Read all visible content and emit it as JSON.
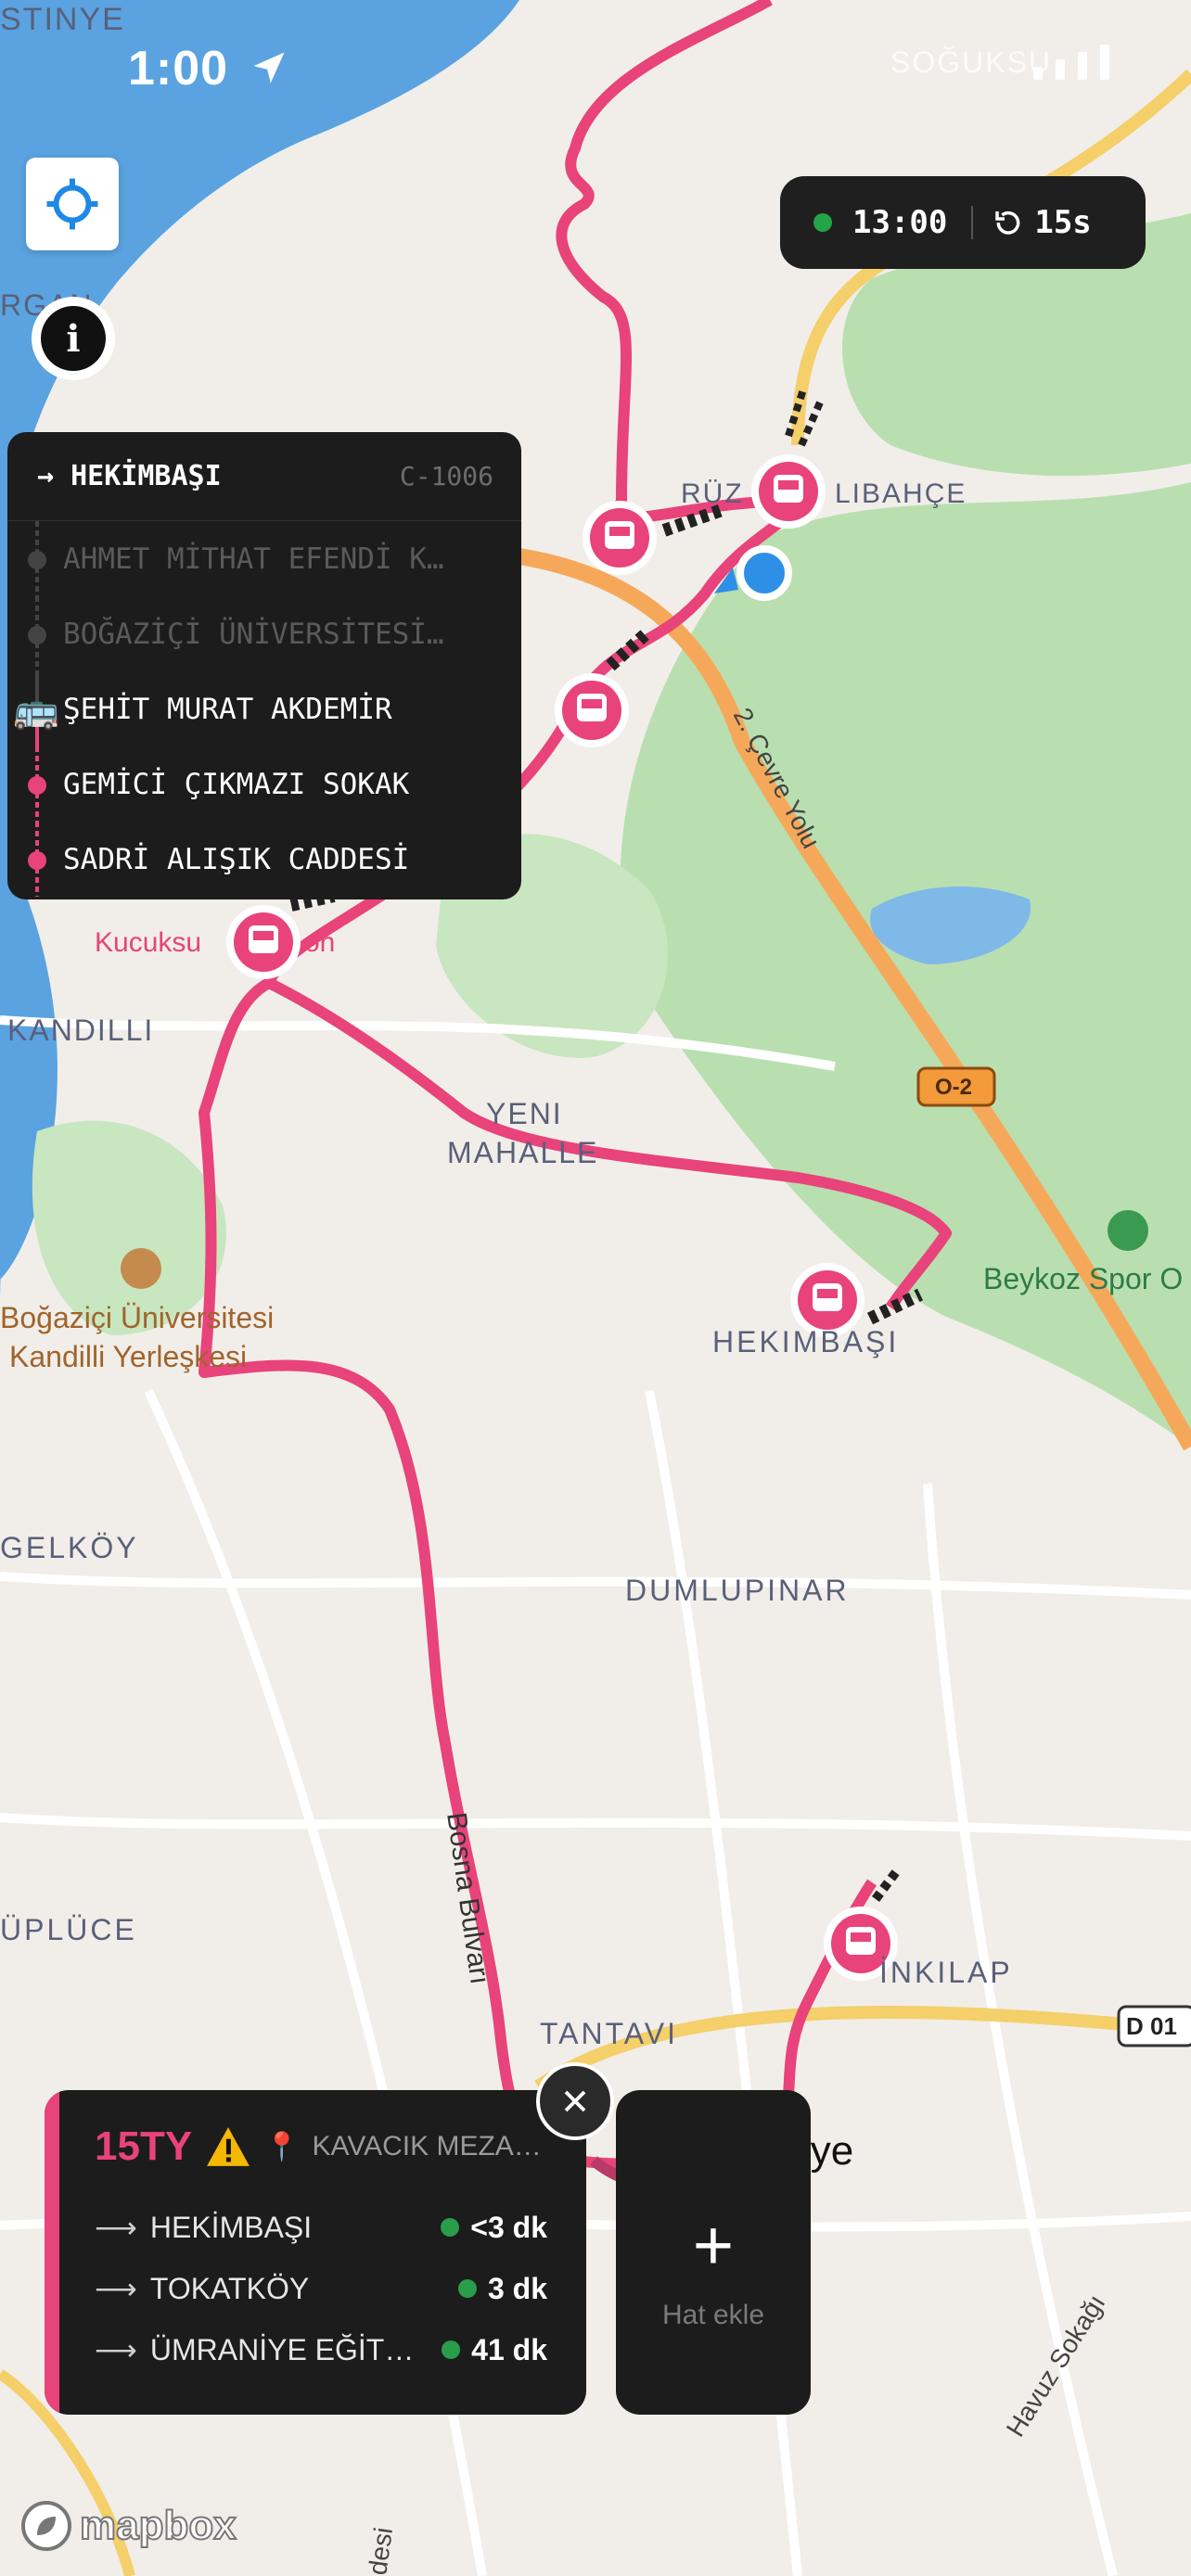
{
  "status_bar": {
    "time": "1:00"
  },
  "map": {
    "labels": {
      "istinye": "STINYE",
      "sogukpinar": "SOĞUKSU",
      "organ": "RGAN",
      "ruzgarlibahce": "RÜZ",
      "ruzgarlibahce2": "LIBAHÇE",
      "cevre_yolu": "2. Çevre Yolu",
      "kucuksu": "Kucuksu",
      "kucuksu2": "on",
      "kandilli": "KANDILLI",
      "yeni": "YENI",
      "mahalle": "MAHALLE",
      "highway_badge": "O-2",
      "beykoz": "Beykoz Spor O",
      "bogazici_uni": "Boğaziçi Üniversitesi",
      "kandilli_yer": "Kandilli Yerleşkesi",
      "hekimbasi": "HEKIMBAŞI",
      "gelkoy": "GELKÖY",
      "dumlupinar": "DUMLUPINAR",
      "bosna": "Bosna Bulvarı",
      "kuplu": "ÜPLÜCE",
      "inkilap": "İNKILAP",
      "tantavi": "TANTAVI",
      "d01": "D 01",
      "umraniye": "Ümraniye",
      "havuz": "Havuz Sokağı",
      "alt": "desi"
    }
  },
  "clock": {
    "time": "13:00",
    "refresh": "15s"
  },
  "route_panel": {
    "destination": "→ HEKİMBAŞI",
    "code": "C-1006",
    "stops": [
      {
        "name": "AHMET MİTHAT EFENDİ K…",
        "state": "past"
      },
      {
        "name": "BOĞAZİÇİ ÜNİVERSİTESİ…",
        "state": "past"
      },
      {
        "name": "ŞEHİT MURAT AKDEMİR",
        "state": "current"
      },
      {
        "name": "GEMİCİ ÇIKMAZI SOKAK",
        "state": "upcoming"
      },
      {
        "name": "SADRİ ALIŞIK CADDESİ",
        "state": "upcoming"
      }
    ]
  },
  "line_card": {
    "line": "15TY",
    "location": "KAVACIK MEZA…",
    "departures": [
      {
        "dest": "HEKİMBAŞI",
        "eta": "<3 dk"
      },
      {
        "dest": "TOKATKÖY",
        "eta": "3 dk"
      },
      {
        "dest": "ÜMRANİYE EĞİT…",
        "eta": "41 dk"
      }
    ],
    "arrow": "⟶"
  },
  "add_line": {
    "plus": "+",
    "label": "Hat ekle"
  },
  "attribution": {
    "logo_text": "mapbox"
  },
  "colors": {
    "route": "#e8437a",
    "accent_green": "#22a447",
    "panel_bg": "#1c1c1c",
    "water": "#5aa3e0",
    "park": "#b9dfb0"
  },
  "icons": [
    "location-arrow-icon",
    "crosshair-icon",
    "info-icon",
    "refresh-icon",
    "bus-icon",
    "warning-icon",
    "pin-icon",
    "close-icon",
    "plus-icon",
    "mapbox-logo-icon",
    "park-icon",
    "university-icon"
  ]
}
